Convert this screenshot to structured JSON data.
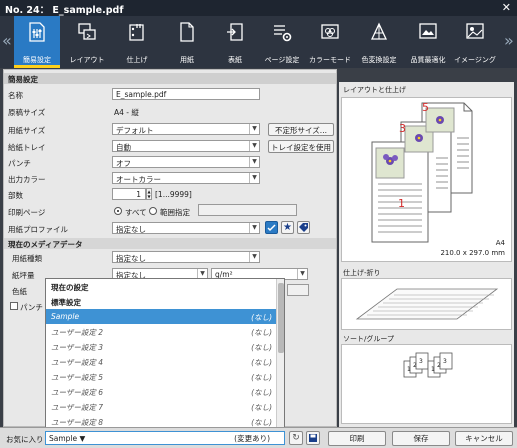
{
  "window": {
    "title": "No. 24： E_sample.pdf",
    "close": "✕"
  },
  "ribbon": {
    "prev": "«",
    "next": "»",
    "tabs": [
      {
        "label": "簡易設定",
        "icon": "basic-settings-icon",
        "selected": true
      },
      {
        "label": "レイアウト",
        "icon": "layout-icon",
        "selected": false
      },
      {
        "label": "仕上げ",
        "icon": "finishing-icon",
        "selected": false
      },
      {
        "label": "用紙",
        "icon": "paper-icon",
        "selected": false
      },
      {
        "label": "表紙",
        "icon": "cover-icon",
        "selected": false
      },
      {
        "label": "ページ設定",
        "icon": "page-settings-icon",
        "selected": false
      },
      {
        "label": "カラーモード",
        "icon": "color-mode-icon",
        "selected": false
      },
      {
        "label": "色変換設定",
        "icon": "color-conversion-icon",
        "selected": false
      },
      {
        "label": "品質最適化",
        "icon": "quality-icon",
        "selected": false
      },
      {
        "label": "イメージング",
        "icon": "imaging-icon",
        "selected": false
      }
    ]
  },
  "form": {
    "section_title": "簡易設定",
    "name_label": "名称",
    "name_value": "E_sample.pdf",
    "orig_size_label": "原稿サイズ",
    "orig_size_value": "A4 - 縦",
    "paper_size_label": "用紙サイズ",
    "paper_size_value": "デフォルト",
    "irregular_btn": "不定形サイズ...",
    "tray_label": "給紙トレイ",
    "tray_value": "自動",
    "tray_btn": "トレイ設定を使用",
    "punch_label": "パンチ",
    "punch_value": "オフ",
    "color_label": "出力カラー",
    "color_value": "オートカラー",
    "copies_label": "部数",
    "copies_value": "1",
    "copies_range": "[1...9999]",
    "print_pages_label": "印刷ページ",
    "all_label": "すべて",
    "range_label": "範囲指定",
    "paper_profile_label": "用紙プロファイル",
    "paper_profile_value": "指定なし",
    "media_section": "現在のメディアデータ",
    "paper_type_label": "用紙種類",
    "paper_type_value": "指定なし",
    "weight_label": "紙坪量",
    "weight_value": "指定なし",
    "weight_unit": "g/m²",
    "paper_color_label": "色紙",
    "punched_label": "パンチ"
  },
  "preview": {
    "layout_title": "レイアウトと仕上げ",
    "page_numbers": [
      "1",
      "3",
      "5"
    ],
    "size_name": "A4",
    "size_dims": "210.0 x 297.0 mm",
    "fold_title": "仕上げ-折り",
    "sort_title": "ソート/グループ",
    "stack_numbers": [
      "1",
      "2",
      "3",
      "1",
      "2",
      "3"
    ]
  },
  "dropdown": {
    "header1": "現在の設定",
    "header2": "標準設定",
    "items": [
      {
        "label": "Sample",
        "value": "(なし)"
      },
      {
        "label": "ユーザー設定 2",
        "value": "(なし)"
      },
      {
        "label": "ユーザー設定 3",
        "value": "(なし)"
      },
      {
        "label": "ユーザー設定 4",
        "value": "(なし)"
      },
      {
        "label": "ユーザー設定 5",
        "value": "(なし)"
      },
      {
        "label": "ユーザー設定 6",
        "value": "(なし)"
      },
      {
        "label": "ユーザー設定 7",
        "value": "(なし)"
      },
      {
        "label": "ユーザー設定 8",
        "value": "(なし)"
      }
    ]
  },
  "bottom": {
    "favorites_label": "お気に入り",
    "favorites_value": "Sample",
    "favorites_status": "(変更あり)",
    "print_btn": "印刷",
    "save_btn": "保存",
    "cancel_btn": "キャンセル"
  },
  "colors": {
    "accent": "#2a7ac4",
    "highlight": "#3e92d4",
    "tab_underline": "#ffd11a",
    "page_number": "#d42b2b"
  }
}
